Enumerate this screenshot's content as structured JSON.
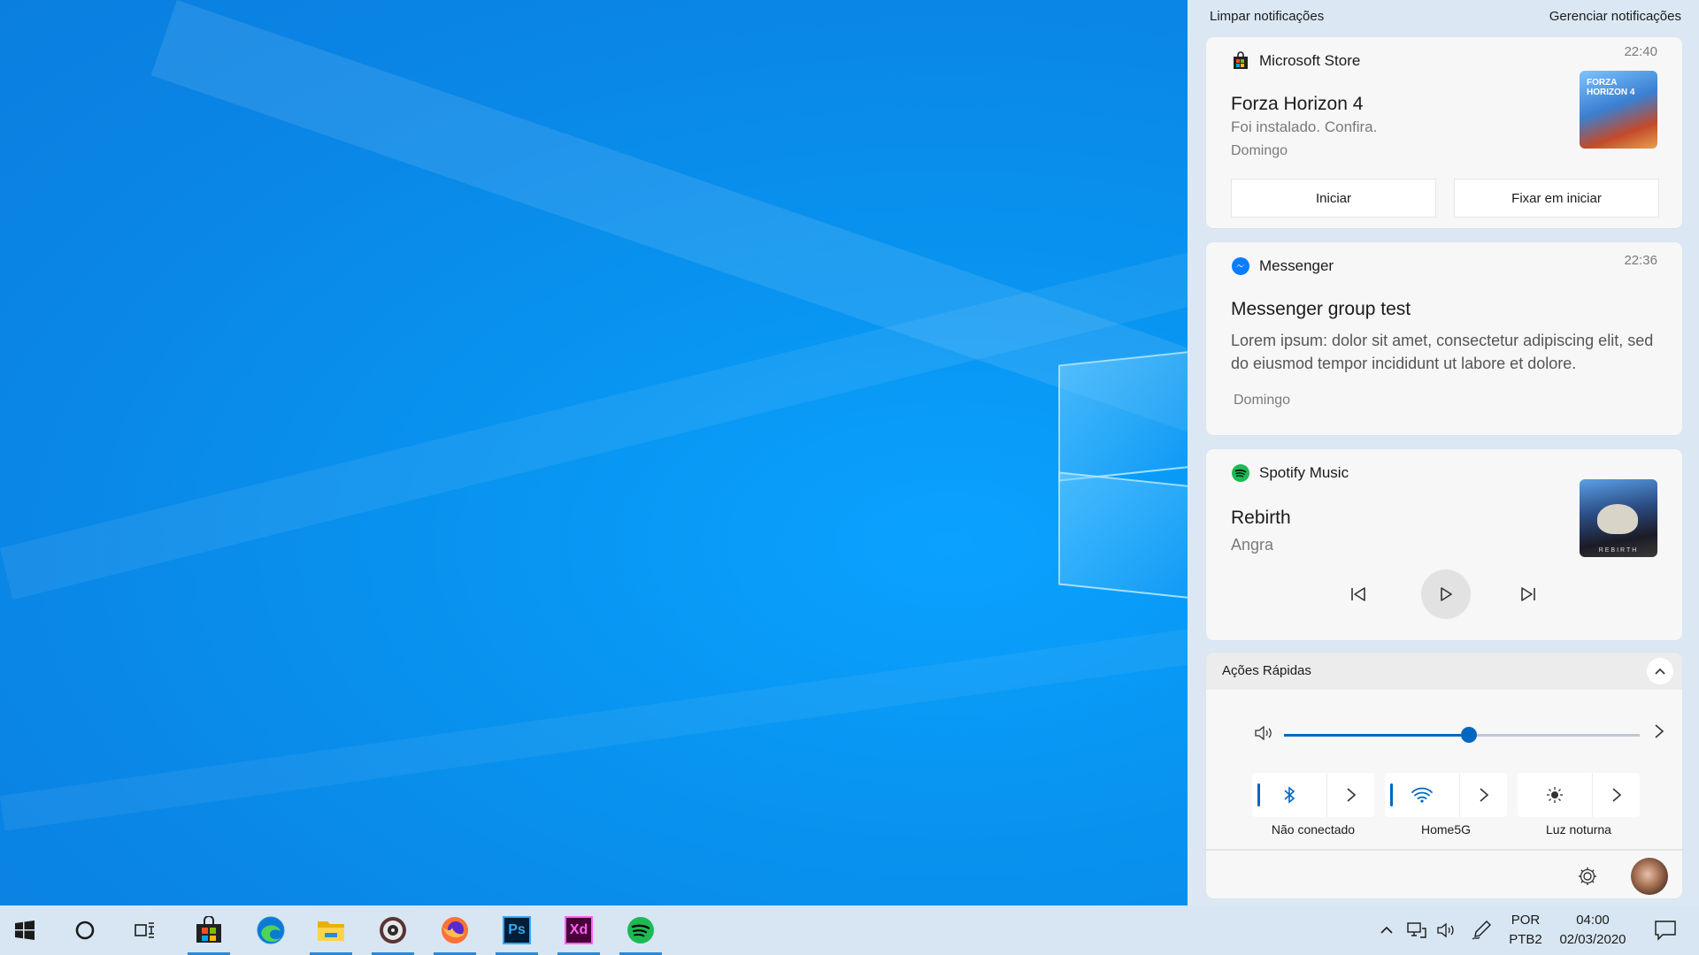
{
  "action_center": {
    "clear_label": "Limpar notificações",
    "manage_label": "Gerenciar notificações",
    "notifications": [
      {
        "app": "Microsoft Store",
        "time": "22:40",
        "title": "Forza Horizon 4",
        "subtitle": "Foi instalado. Confira.",
        "day": "Domingo",
        "buttons": [
          "Iniciar",
          "Fixar em iniciar"
        ],
        "thumb_text": "FORZA HORIZON 4"
      },
      {
        "app": "Messenger",
        "time": "22:36",
        "title": "Messenger group test",
        "body": "Lorem ipsum: dolor sit amet, consectetur adipiscing elit, sed do eiusmod tempor incididunt ut labore et dolore.",
        "day": "Domingo"
      },
      {
        "app": "Spotify Music",
        "title": "Rebirth",
        "artist": "Angra",
        "thumb_text": "REBIRTH"
      }
    ],
    "quick_actions": {
      "header": "Ações Rápidas",
      "volume_level": 0.52,
      "tiles": [
        {
          "icon": "bluetooth-icon",
          "label": "Não conectado",
          "active": true
        },
        {
          "icon": "wifi-icon",
          "label": "Home5G",
          "active": true
        },
        {
          "icon": "night-light-icon",
          "label": "Luz noturna",
          "active": false
        }
      ]
    }
  },
  "taskbar": {
    "apps": [
      "start-icon",
      "cortana-icon",
      "task-view-icon",
      "microsoft-store-icon",
      "edge-icon",
      "file-explorer-icon",
      "groove-music-icon",
      "firefox-icon",
      "photoshop-icon",
      "adobe-xd-icon",
      "spotify-icon"
    ],
    "ps_label": "Ps",
    "xd_label": "Xd",
    "language": "POR",
    "layout": "PTB2",
    "time": "04:00",
    "date": "02/03/2020"
  },
  "colors": {
    "accent": "#0067c0",
    "spotify": "#1db954",
    "messenger": "#0a7cff"
  }
}
